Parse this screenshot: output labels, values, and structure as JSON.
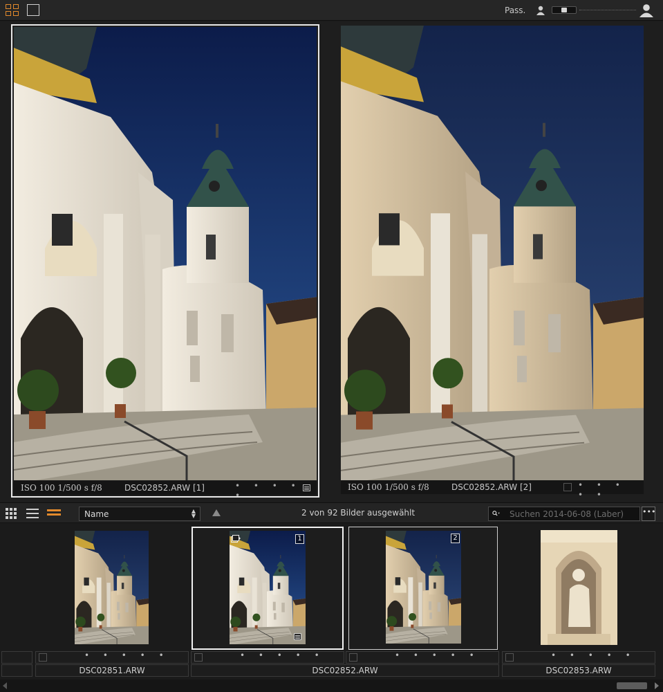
{
  "toolbar": {
    "pass_label": "Pass."
  },
  "compare": {
    "left": {
      "meta": "ISO 100 1/500 s f/8",
      "filename": "DSC02852.ARW [1]",
      "rating_dots": "• • • • •"
    },
    "right": {
      "meta": "ISO 100 1/500 s f/8",
      "filename": "DSC02852.ARW [2]",
      "rating_dots": "• • • • •"
    }
  },
  "strip_toolbar": {
    "sort_value": "Name",
    "selection_status": "2 von 92 Bilder ausgewählt",
    "search_placeholder": "Suchen 2014-06-08 (Laber)",
    "more_label": "•••"
  },
  "filmstrip": {
    "items": [
      {
        "filename": "DSC02851.ARW",
        "rating_dots": "• • • • •"
      },
      {
        "filename": "DSC02852.ARW",
        "badge": "1",
        "rating_dots": "• • • • •"
      },
      {
        "filename": "DSC02852.ARW",
        "badge": "2",
        "rating_dots": "• • • • •"
      },
      {
        "filename": "DSC02853.ARW",
        "rating_dots": "• • • • •"
      }
    ]
  },
  "colors": {
    "accent": "#e38a2c",
    "background": "#1c1c1c",
    "selection_border": "#f2f2f2"
  }
}
